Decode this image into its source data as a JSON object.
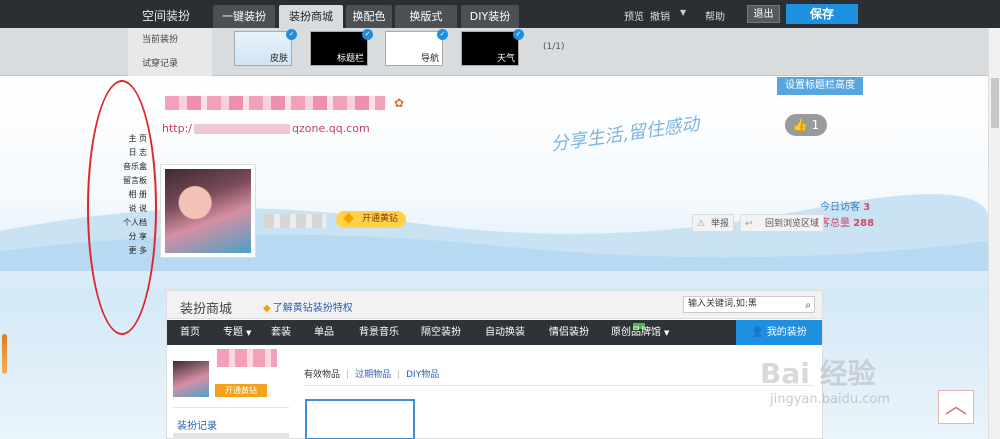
{
  "topbar": {
    "title": "空间装扮",
    "tabs": [
      "一键装扮",
      "装扮商城",
      "换配色",
      "换版式",
      "DIY装扮"
    ],
    "active_tab": "装扮商城",
    "preview": "预览",
    "undo": "撤销",
    "help": "帮助",
    "exit": "退出",
    "save": "保存"
  },
  "panel": {
    "side_items": [
      "当前装扮",
      "试穿记录"
    ],
    "thumbs": [
      "皮肤",
      "标题栏",
      "导航",
      "天气"
    ],
    "pager": "(1/1)"
  },
  "nav": {
    "items": [
      "主 页",
      "日 志",
      "音乐盒",
      "留言板",
      "相 册",
      "说 说",
      "个人档",
      "分 享",
      "更 多"
    ]
  },
  "profile": {
    "url_prefix": "http:/",
    "url_suffix": "qzone.qq.com",
    "vip_button": "开通黄钻",
    "like_count": "1",
    "set_title_height": "设置标题栏高度",
    "slogan": "分享生活,留住感动",
    "today_visitors_label": "今日访客",
    "today_visitors_value": "3",
    "total_visitors_label": "客总量",
    "total_visitors_value": "288",
    "report": "举报",
    "back_to_browse": "回到浏览区域"
  },
  "mall": {
    "title": "装扮商城",
    "vip_link": "了解黄钻装扮特权",
    "search_placeholder": "输入关键词,如:黑",
    "menu": [
      "首页",
      "专题",
      "套装",
      "单品",
      "背景音乐",
      "隔空装扮",
      "自动换装",
      "情侣装扮",
      "原创品牌馆"
    ],
    "my_dressup": "我的装扮",
    "my_vip": "开通黄钻",
    "history": "装扮记录",
    "tabs": [
      "有效物品",
      "过期物品",
      "DIY物品"
    ]
  },
  "watermark": {
    "main": "Bai 经验",
    "sub": "jingyan.baidu.com"
  },
  "colors": {
    "accent": "#1f8fe0",
    "topbar": "#2b2f33",
    "highlight_ellipse": "#e0262a"
  }
}
